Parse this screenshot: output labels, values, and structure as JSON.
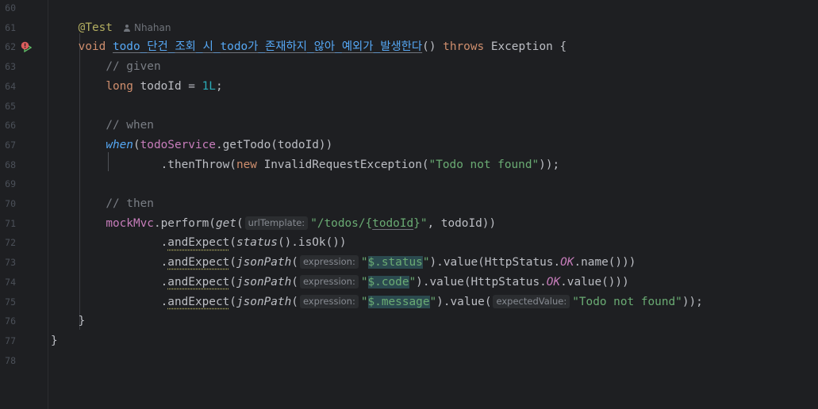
{
  "editor": {
    "author": "Nhahan",
    "lines": [
      {
        "n": "60"
      },
      {
        "n": "61",
        "ann": "@Test"
      },
      {
        "n": "62",
        "kw_void": "void",
        "method": "todo_단건_조회_시_todo가_존재하지_않아_예외가_발생한다",
        "paren": "() ",
        "kw_throws": "throws",
        "rest": " Exception {"
      },
      {
        "n": "63",
        "comment": "// given"
      },
      {
        "n": "64",
        "kw": "long",
        "mid": " todoId = ",
        "num": "1L",
        "end": ";"
      },
      {
        "n": "65"
      },
      {
        "n": "66",
        "comment": "// when"
      },
      {
        "n": "67",
        "fn": "when",
        "p1": "(",
        "fld": "todoService",
        "rest": ".getTodo(todoId))"
      },
      {
        "n": "68",
        "p1": ".thenThrow(",
        "kw": "new",
        "cls": " InvalidRequestException(",
        "str": "\"Todo not found\"",
        "end": "));"
      },
      {
        "n": "69"
      },
      {
        "n": "70",
        "comment": "// then"
      },
      {
        "n": "71",
        "fld": "mockMvc",
        "p1": ".perform(",
        "fn": "get",
        "p2": "(",
        "hint": "urlTemplate:",
        "s1": "\"/todos/{",
        "s2": "todoId",
        "s3": "}\"",
        "end": ", todoId))"
      },
      {
        "n": "72",
        "p1": ".",
        "m": "andExpect",
        "p2": "(",
        "fn": "status",
        "end": "().isOk())"
      },
      {
        "n": "73",
        "p1": ".",
        "m": "andExpect",
        "p2": "(",
        "fn": "jsonPath",
        "p3": "(",
        "hint": "expression:",
        "s1": "\"",
        "s2": "$.status",
        "s3": "\"",
        "mid": ").value(HttpStatus.",
        "fi": "OK",
        "end": ".name()))"
      },
      {
        "n": "74",
        "p1": ".",
        "m": "andExpect",
        "p2": "(",
        "fn": "jsonPath",
        "p3": "(",
        "hint": "expression:",
        "s1": "\"",
        "s2": "$.code",
        "s3": "\"",
        "mid": ").value(HttpStatus.",
        "fi": "OK",
        "end": ".value()))"
      },
      {
        "n": "75",
        "p1": ".",
        "m": "andExpect",
        "p2": "(",
        "fn": "jsonPath",
        "p3": "(",
        "hint": "expression:",
        "s1": "\"",
        "s2": "$.message",
        "s3": "\"",
        "mid": ").value(",
        "hint2": "expectedValue:",
        "str": "\"Todo not found\"",
        "end": "));"
      },
      {
        "n": "76",
        "brace": "}"
      },
      {
        "n": "77",
        "brace": "}"
      },
      {
        "n": "78"
      }
    ]
  }
}
